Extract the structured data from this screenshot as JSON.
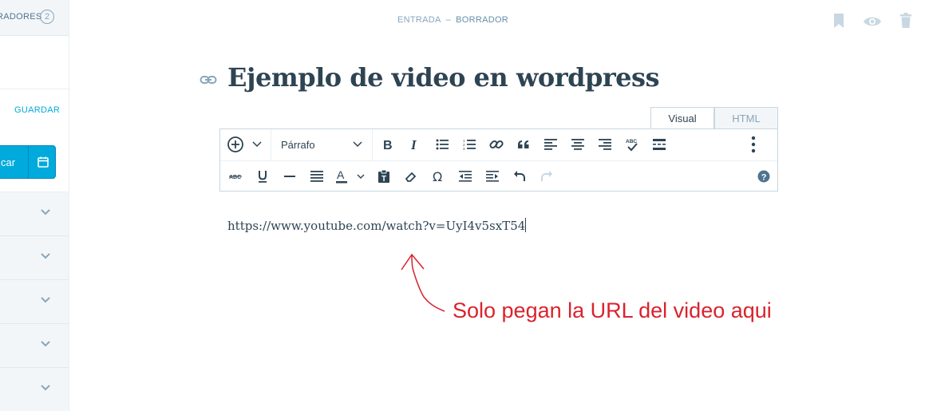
{
  "sidebar": {
    "drafts_label": "RADORES",
    "drafts_count": "2",
    "save_label": "GUARDAR",
    "publish_label": "car",
    "calendar_icon": "calendar-icon",
    "accordion_icon": "chevron-down-icon"
  },
  "header": {
    "post_type": "ENTRADA",
    "separator": "–",
    "status": "BORRADOR",
    "icons": [
      "bookmark-icon",
      "eye-icon",
      "trash-icon"
    ]
  },
  "editor": {
    "title": "Ejemplo de video en wordpress",
    "tabs": [
      {
        "label": "Visual",
        "active": true
      },
      {
        "label": "HTML",
        "active": false
      }
    ],
    "format_select": "Párrafo",
    "content": "https://www.youtube.com/watch?v=UyI4v5sxT54"
  },
  "annotation": {
    "text": "Solo pegan la URL del video aqui",
    "color": "#d9232d"
  },
  "colors": {
    "accent": "#00aadc",
    "text": "#2e4453",
    "muted": "#87a6bc"
  }
}
